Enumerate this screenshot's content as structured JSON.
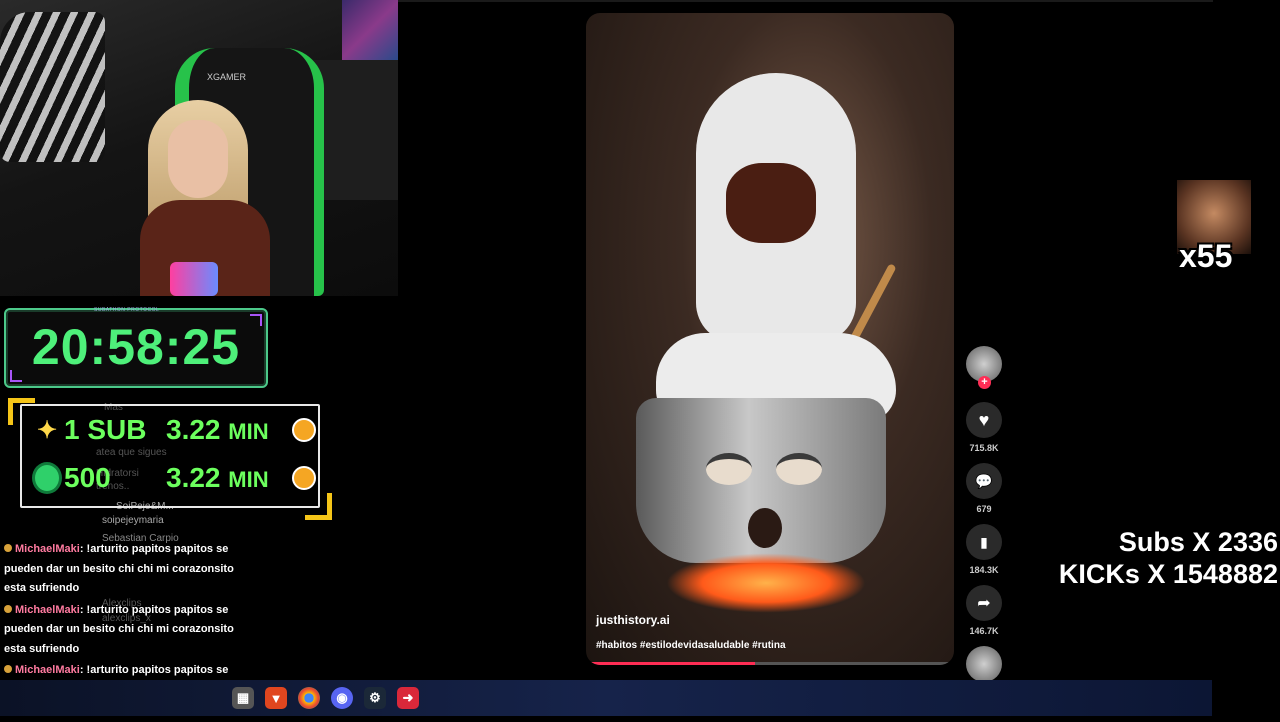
{
  "webcam": {
    "chair_logo": "XGAMER"
  },
  "timer": {
    "label": "SUBATHON PROTOCOL",
    "time": "20:58:25"
  },
  "goals": [
    {
      "label": "1 SUB",
      "value": "3.22",
      "unit": "MIN"
    },
    {
      "label": "500",
      "value": "3.22",
      "unit": "MIN"
    }
  ],
  "faint_chat": [
    "Mas",
    "atea que sigues",
    "Hidratorsi",
    "trenos..",
    "SoiPeje&M...",
    "soipejeymaria",
    "Sebastian Carpio",
    "Alexclips",
    "alexclips_x"
  ],
  "chat": [
    {
      "user": "MichaelMaki",
      "text": ": !arturito papitos papitos se pueden dar un besito chi chi mi corazonsito esta sufriendo"
    },
    {
      "user": "MichaelMaki",
      "text": ": !arturito papitos papitos se pueden dar un besito chi chi mi corazonsito esta sufriendo"
    },
    {
      "user": "MichaelMaki",
      "text": ": !arturito papitos papitos se pueden dar un besito chi chi mi corazonsito esta sufriendo"
    }
  ],
  "video": {
    "credit": "justhistory.ai",
    "tags": "#habitos #estilodevidasaludable #rutina",
    "progress": 0.46
  },
  "actions": {
    "likes": "715.8K",
    "comments": "679",
    "saves": "184.3K",
    "shares": "146.7K"
  },
  "emote": {
    "multiplier": "x55"
  },
  "counters": {
    "subs": "Subs X 2336",
    "kicks": "KICKs X 1548882"
  },
  "taskbar": {
    "icons": [
      "file-explorer-icon",
      "brave-icon",
      "chrome-icon",
      "discord-icon",
      "steam-icon",
      "app-icon"
    ]
  }
}
